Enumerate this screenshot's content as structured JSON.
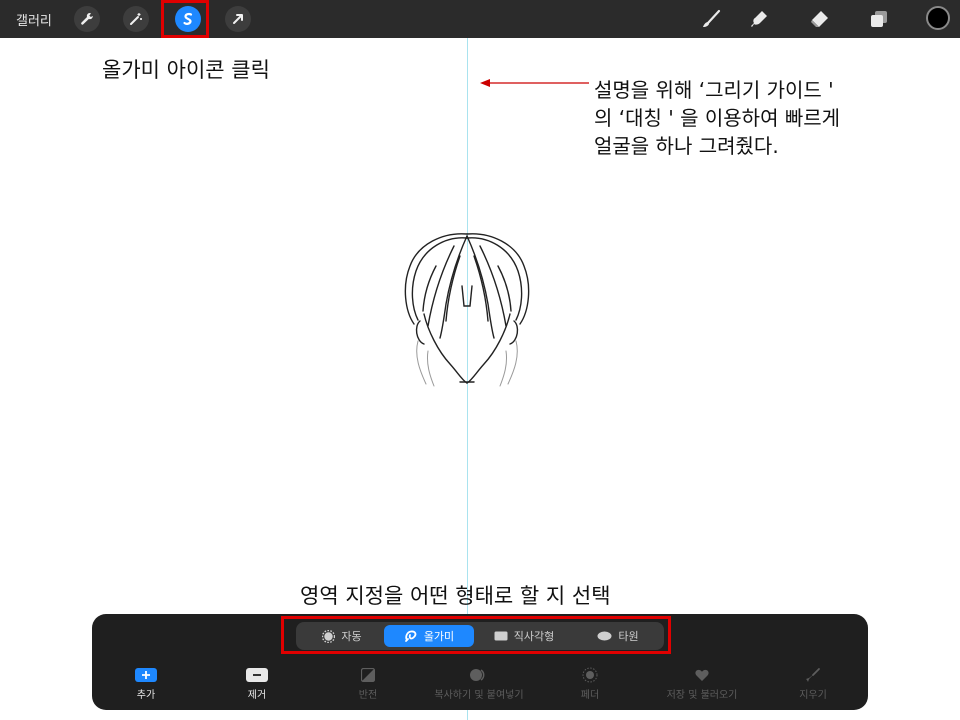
{
  "topbar": {
    "gallery_label": "갤러리",
    "tools": [
      {
        "icon": "wrench-icon"
      },
      {
        "icon": "magic-wand-icon"
      },
      {
        "icon": "selection-s-icon",
        "active": true
      },
      {
        "icon": "transform-arrow-icon"
      }
    ],
    "right_tools": [
      "brush-icon",
      "smudge-icon",
      "eraser-icon",
      "layers-icon"
    ],
    "current_color": "#000000"
  },
  "annotations": {
    "top_caption": "올가미 아이콘 클릭",
    "side_note": "설명을 위해 ‘그리기 가이드 '\n의 ‘대칭 ' 을 이용하여 빠르게\n얼굴을 하나 그려줬다.",
    "bottom_caption": "영역 지정을 어떤 형태로 할 지 선택"
  },
  "selection_modes": [
    {
      "label": "자동",
      "icon": "auto-icon",
      "active": false
    },
    {
      "label": "올가미",
      "icon": "lasso-icon",
      "active": true
    },
    {
      "label": "직사각형",
      "icon": "rectangle-icon",
      "active": false
    },
    {
      "label": "타원",
      "icon": "ellipse-icon",
      "active": false
    }
  ],
  "actions": [
    {
      "label": "추가",
      "icon": "plus-icon",
      "enabled": true
    },
    {
      "label": "제거",
      "icon": "minus-icon",
      "enabled": true
    },
    {
      "label": "반전",
      "icon": "invert-icon",
      "enabled": false
    },
    {
      "label": "복사하기 및 붙여넣기",
      "icon": "copy-paste-icon",
      "enabled": false
    },
    {
      "label": "페더",
      "icon": "feather-icon",
      "enabled": false
    },
    {
      "label": "저장 및 불러오기",
      "icon": "heart-icon",
      "enabled": false
    },
    {
      "label": "지우기",
      "icon": "clear-icon",
      "enabled": false
    }
  ],
  "colors": {
    "accent": "#1e88ff",
    "highlight": "#e00000",
    "guide": "#a9e3ef"
  }
}
